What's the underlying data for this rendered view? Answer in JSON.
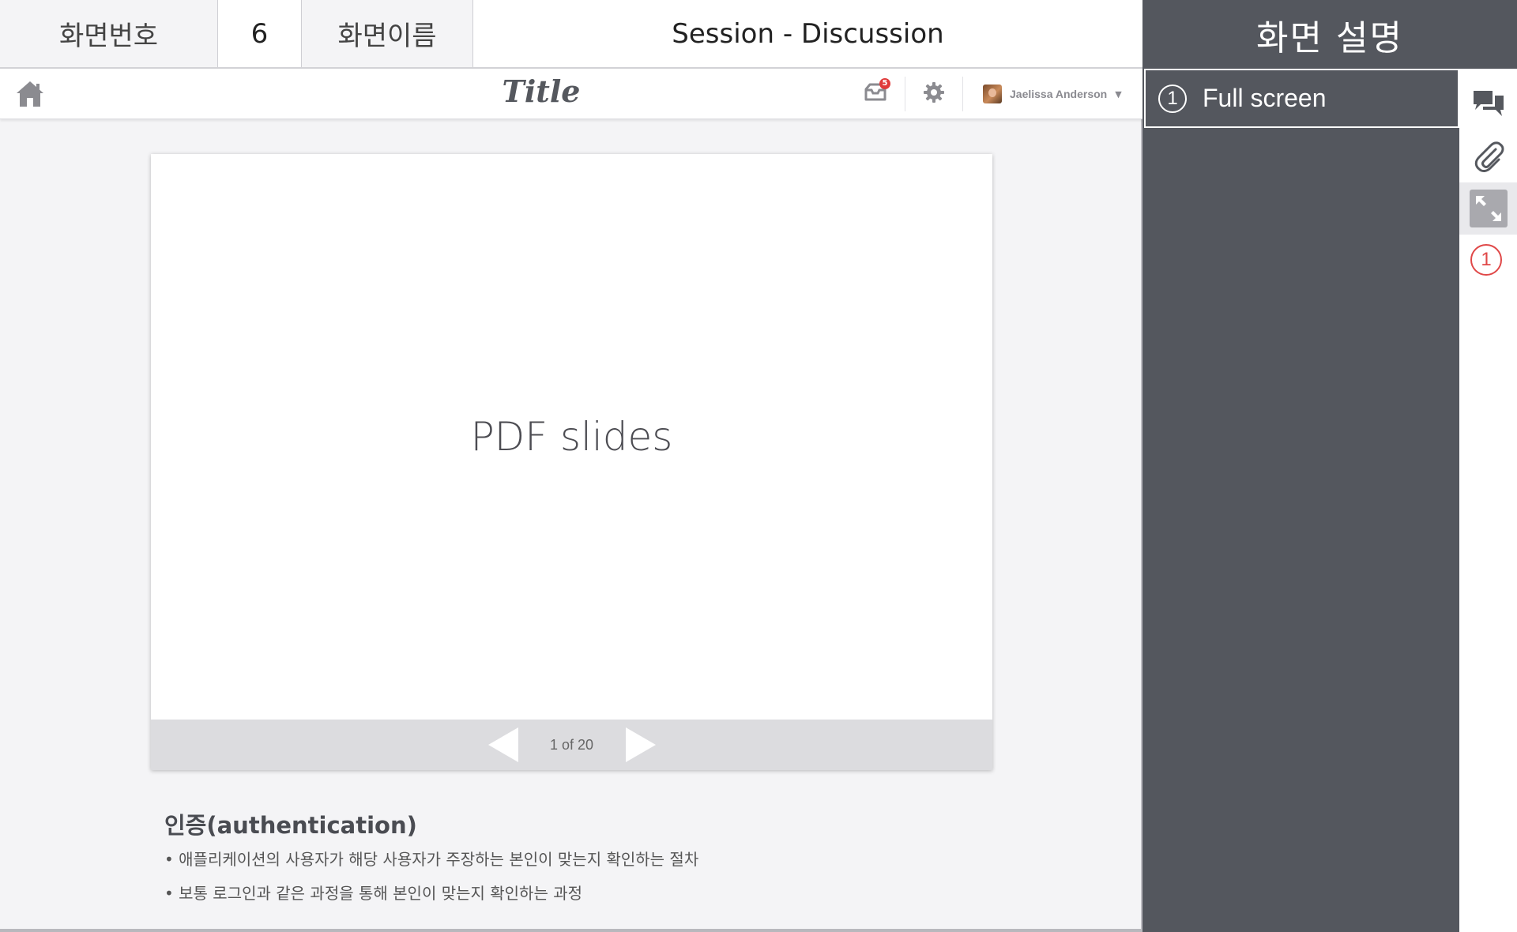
{
  "spec_header": {
    "screen_number_label": "화면번호",
    "screen_number": "6",
    "screen_name_label": "화면이름",
    "screen_name": "Session - Discussion",
    "description_title": "화면 설명"
  },
  "topbar": {
    "title": "Title",
    "notification_count": "5",
    "user_name": "Jaelissa Anderson",
    "icons": [
      "home-icon",
      "notification-icon",
      "gear-icon",
      "chevron-down-icon"
    ]
  },
  "slide": {
    "content": "PDF slides",
    "page_indicator": "1 of 20",
    "icons": [
      "prev-arrow-icon",
      "next-arrow-icon"
    ]
  },
  "notes": {
    "title": "인증(authentication)",
    "lines": [
      "• 애플리케이션의 사용자가 해당 사용자가 주장하는 본인이 맞는지 확인하는 절차",
      "• 보통 로그인과 같은 과정을 통해 본인이 맞는지 확인하는 과정"
    ]
  },
  "description": {
    "items": [
      {
        "number": "1",
        "text": "Full screen"
      }
    ]
  },
  "icon_strip": {
    "icons": [
      "chat-icon",
      "paperclip-icon",
      "fullscreen-icon"
    ],
    "active": "fullscreen-icon",
    "marker": "1"
  },
  "colors": {
    "panel_dark": "#54575e",
    "marker_red": "#e04848",
    "badge_red": "#e03a3a"
  }
}
